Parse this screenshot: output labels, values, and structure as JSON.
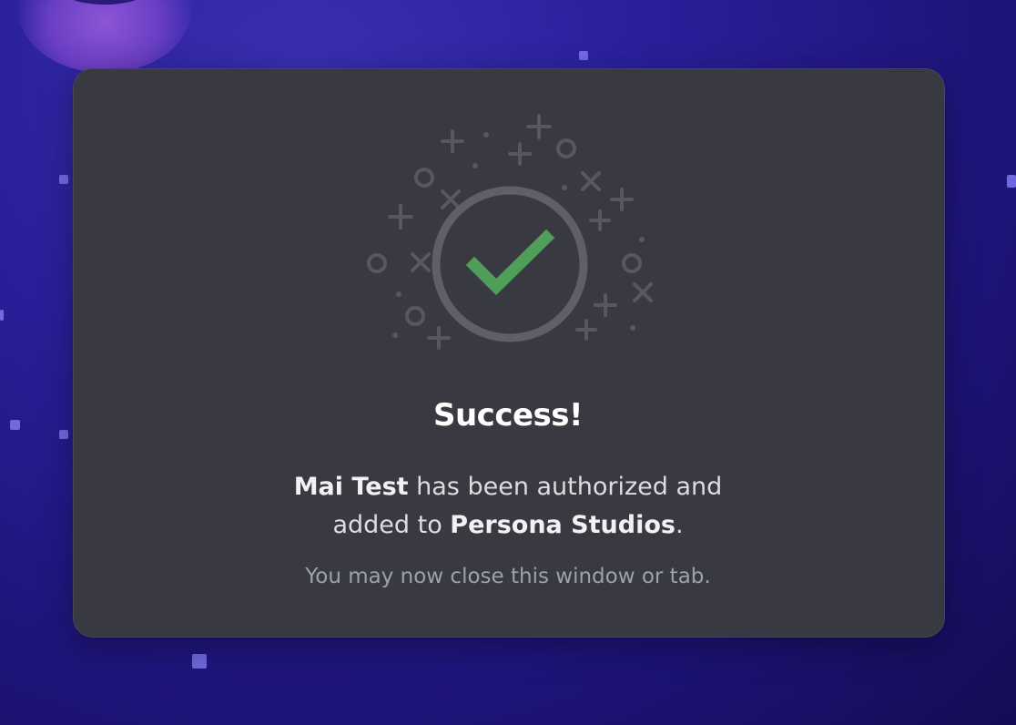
{
  "colors": {
    "modal_bg": "#393a41",
    "check_green": "#4f9f5a",
    "ring_gray": "#5f6066"
  },
  "icon": "success-checkmark-icon",
  "title": "Success!",
  "message": {
    "app_name": "Mai Test",
    "line1_rest": " has been authorized and",
    "line2_prefix": "added to ",
    "server_name": "Persona Studios",
    "line2_suffix": "."
  },
  "hint": "You may now close this window or tab."
}
